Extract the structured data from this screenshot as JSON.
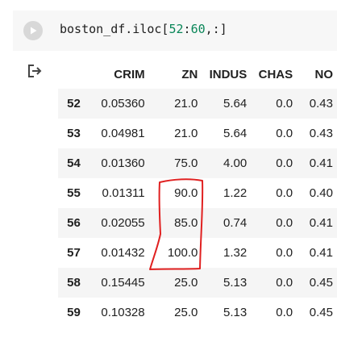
{
  "code_cell": {
    "run_icon": "play-icon",
    "code_prefix": "boston_df.iloc[",
    "code_num1": "52",
    "code_colon": ":",
    "code_num2": "60",
    "code_suffix": ",:]"
  },
  "output": {
    "icon": "output-arrow-icon",
    "columns": [
      "",
      "CRIM",
      "ZN",
      "INDUS",
      "CHAS",
      "NO"
    ],
    "rows": [
      [
        "52",
        "0.05360",
        "21.0",
        "5.64",
        "0.0",
        "0.43"
      ],
      [
        "53",
        "0.04981",
        "21.0",
        "5.64",
        "0.0",
        "0.43"
      ],
      [
        "54",
        "0.01360",
        "75.0",
        "4.00",
        "0.0",
        "0.41"
      ],
      [
        "55",
        "0.01311",
        "90.0",
        "1.22",
        "0.0",
        "0.40"
      ],
      [
        "56",
        "0.02055",
        "85.0",
        "0.74",
        "0.0",
        "0.41"
      ],
      [
        "57",
        "0.01432",
        "100.0",
        "1.32",
        "0.0",
        "0.41"
      ],
      [
        "58",
        "0.15445",
        "25.0",
        "5.13",
        "0.0",
        "0.45"
      ],
      [
        "59",
        "0.10328",
        "25.0",
        "5.13",
        "0.0",
        "0.45"
      ]
    ]
  },
  "annotation": {
    "color": "#e02020"
  }
}
